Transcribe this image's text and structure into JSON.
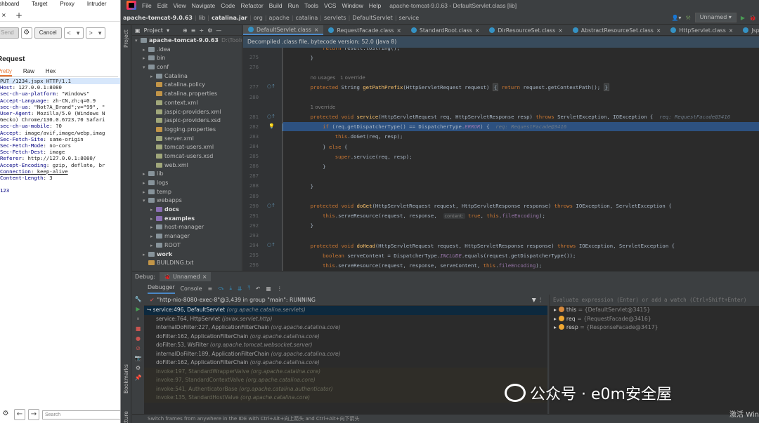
{
  "burp": {
    "menu": [
      "Dashboard",
      "Target",
      "Proxy",
      "Intruder"
    ],
    "toolbar": {
      "send": "Send",
      "settings_icon": "gear-icon",
      "cancel": "Cancel",
      "prev": "<",
      "prev_dd": "▾",
      "next": ">",
      "next_dd": "▾"
    },
    "heading": "Request",
    "tabs": [
      "Pretty",
      "Raw",
      "Hex"
    ],
    "request_lines": [
      {
        "t": "PUT /1234.jspx HTTP/1.1",
        "cls": "sel"
      },
      {
        "k": "Host",
        "v": ": 127.0.0.1:8080"
      },
      {
        "k": "sec-ch-ua-platform",
        "v": ": \"Windows\""
      },
      {
        "k": "Accept-Language",
        "v": ": zh-CN,zh;q=0.9"
      },
      {
        "k": "sec-ch-ua",
        "v": ": \"Not?A_Brand\";v=\"99\", \""
      },
      {
        "k": "User-Agent",
        "v": ": Mozilla/5.0 (Windows N"
      },
      {
        "t": "Gecko) Chrome/130.0.6723.70 Safari"
      },
      {
        "k": "sec-ch-ua-mobile",
        "v": ": ?0"
      },
      {
        "k": "Accept",
        "v": ": image/avif,image/webp,imag"
      },
      {
        "k": "Sec-Fetch-Site",
        "v": ": same-origin"
      },
      {
        "k": "Sec-Fetch-Mode",
        "v": ": no-cors"
      },
      {
        "k": "Sec-Fetch-Dest",
        "v": ": image"
      },
      {
        "k": "Referer",
        "v": ": http://127.0.0.1:8080/"
      },
      {
        "k": "Accept-Encoding",
        "v": ": gzip, deflate, br"
      },
      {
        "k": "Connection",
        "v": ": keep-alive",
        "cls": "u"
      },
      {
        "k": "Content-Length",
        "v": ": 3"
      },
      {
        "t": ""
      },
      {
        "t": "123",
        "cls": "body"
      }
    ],
    "search_placeholder": "Search"
  },
  "ide": {
    "menu": [
      "File",
      "Edit",
      "View",
      "Navigate",
      "Code",
      "Refactor",
      "Build",
      "Run",
      "Tools",
      "VCS",
      "Window",
      "Help"
    ],
    "title": "apache-tomcat-9.0.63 - DefaultServlet.class [lib]",
    "breadcrumb": [
      "apache-tomcat-9.0.63",
      "lib",
      "catalina.jar",
      "org",
      "apache",
      "catalina",
      "servlets",
      "DefaultServlet",
      "service"
    ],
    "run_config": "Unnamed",
    "left_strip": [
      "Project",
      "Bookmarks",
      "Structure"
    ],
    "project_label": "Project",
    "tree": [
      {
        "name": "apache-tomcat-9.0.63",
        "hint": "D:\\Tools\\ap",
        "type": "root",
        "depth": 0,
        "arrow": "▾"
      },
      {
        "name": ".idea",
        "type": "fo",
        "depth": 1,
        "arrow": "▸"
      },
      {
        "name": "bin",
        "type": "fo",
        "depth": 1,
        "arrow": "▸"
      },
      {
        "name": "conf",
        "type": "fo",
        "depth": 1,
        "arrow": "▾"
      },
      {
        "name": "Catalina",
        "type": "fo",
        "depth": 2,
        "arrow": "▸"
      },
      {
        "name": "catalina.policy",
        "type": "fm",
        "depth": 2
      },
      {
        "name": "catalina.properties",
        "type": "fm",
        "depth": 2
      },
      {
        "name": "context.xml",
        "type": "fx",
        "depth": 2
      },
      {
        "name": "jaspic-providers.xml",
        "type": "fx",
        "depth": 2
      },
      {
        "name": "jaspic-providers.xsd",
        "type": "fx",
        "depth": 2
      },
      {
        "name": "logging.properties",
        "type": "fm",
        "depth": 2
      },
      {
        "name": "server.xml",
        "type": "fx",
        "depth": 2
      },
      {
        "name": "tomcat-users.xml",
        "type": "fx",
        "depth": 2
      },
      {
        "name": "tomcat-users.xsd",
        "type": "fx",
        "depth": 2
      },
      {
        "name": "web.xml",
        "type": "fx",
        "depth": 2
      },
      {
        "name": "lib",
        "type": "fo",
        "depth": 1,
        "arrow": "▸"
      },
      {
        "name": "logs",
        "type": "fo",
        "depth": 1,
        "arrow": "▸"
      },
      {
        "name": "temp",
        "type": "fo",
        "depth": 1,
        "arrow": "▸"
      },
      {
        "name": "webapps",
        "type": "fo",
        "depth": 1,
        "arrow": "▾"
      },
      {
        "name": "docs",
        "type": "fw",
        "depth": 2,
        "arrow": "▸",
        "bold": true
      },
      {
        "name": "examples",
        "type": "fw",
        "depth": 2,
        "arrow": "▸",
        "bold": true
      },
      {
        "name": "host-manager",
        "type": "fo",
        "depth": 2,
        "arrow": "▸"
      },
      {
        "name": "manager",
        "type": "fo",
        "depth": 2,
        "arrow": "▸"
      },
      {
        "name": "ROOT",
        "type": "fo",
        "depth": 2,
        "arrow": "▸"
      },
      {
        "name": "work",
        "type": "fo",
        "depth": 1,
        "arrow": "▸",
        "bold": true
      },
      {
        "name": "BUILDING.txt",
        "type": "fm",
        "depth": 1
      }
    ],
    "tabs": [
      "DefaultServlet.class",
      "RequestFacade.class",
      "StandardRoot.class",
      "DirResourceSet.class",
      "AbstractResourceSet.class",
      "HttpServlet.class",
      "JspServlet.class"
    ],
    "banner": "Decompiled .class file, bytecode version: 52.0 (Java 8)",
    "code_lines": [
      {
        "n": "",
        "html": "        <span class=\"kw\">return</span> result.toString();"
      },
      {
        "n": "275",
        "html": "    }"
      },
      {
        "n": "276",
        "html": ""
      },
      {
        "n": "",
        "html": "    <span class=\"cmt\">no usages   1 override</span>"
      },
      {
        "n": "277",
        "html": "    <span class=\"kw\">protected</span> String <span class=\"fn\">getPathPrefix</span>(HttpServletRequest request) <span class=\"fold\">{</span> <span class=\"kw\">return</span> request.getContextPath(); <span class=\"fold\">}</span>",
        "g": "○↑"
      },
      {
        "n": "280",
        "html": ""
      },
      {
        "n": "",
        "html": "    <span class=\"cmt\">1 override</span>"
      },
      {
        "n": "281",
        "html": "    <span class=\"kw\">protected void</span> <span class=\"fn\">service</span>(HttpServletRequest req, HttpServletResponse resp) <span class=\"kw\">throws</span> ServletException, IOException {  <span class=\"hint\">req: RequestFacade@3416</span>",
        "g": "○↑"
      },
      {
        "n": "282",
        "html": "        <span class=\"kw\">if</span> (req.getDispatcherType() == DispatcherType.<span class=\"it\">ERROR</span>) {  <span class=\"hint\">req: RequestFacade@3416</span>",
        "hl": true,
        "g": "💡"
      },
      {
        "n": "283",
        "html": "            <span class=\"kw\">this</span>.doGet(req, resp);"
      },
      {
        "n": "284",
        "html": "        } <span class=\"kw\">else</span> {"
      },
      {
        "n": "285",
        "html": "            <span class=\"kw\">super</span>.service(req, resp);"
      },
      {
        "n": "286",
        "html": "        }"
      },
      {
        "n": "287",
        "html": ""
      },
      {
        "n": "288",
        "html": "    }"
      },
      {
        "n": "289",
        "html": ""
      },
      {
        "n": "290",
        "html": "    <span class=\"kw\">protected void</span> <span class=\"fn\">doGet</span>(HttpServletRequest request, HttpServletResponse response) <span class=\"kw\">throws</span> IOException, ServletException {",
        "g": "○↑"
      },
      {
        "n": "291",
        "html": "        <span class=\"kw\">this</span>.serveResource(request, response,  <span class=\"ann\">content:</span> <span class=\"kw\">true</span>, <span class=\"kw\">this</span>.<span class=\"fd\">fileEncoding</span>);"
      },
      {
        "n": "292",
        "html": "    }"
      },
      {
        "n": "293",
        "html": ""
      },
      {
        "n": "294",
        "html": "    <span class=\"kw\">protected void</span> <span class=\"fn\">doHead</span>(HttpServletRequest request, HttpServletResponse response) <span class=\"kw\">throws</span> IOException, ServletException {",
        "g": "○↑"
      },
      {
        "n": "295",
        "html": "        <span class=\"kw\">boolean</span> serveContent = DispatcherType.<span class=\"it\">INCLUDE</span>.equals(request.getDispatcherType());"
      },
      {
        "n": "296",
        "html": "        <span class=\"kw\">this</span>.serveResource(request, response, serveContent, <span class=\"kw\">this</span>.<span class=\"fd\">fileEncoding</span>);"
      }
    ],
    "debug": {
      "label": "Debug:",
      "session": "Unnamed",
      "tabs": [
        "Debugger",
        "Console"
      ],
      "thread": "\"http-nio-8080-exec-8\"@3,439 in group \"main\": RUNNING",
      "frames": [
        {
          "m": "service:496, DefaultServlet",
          "c": "(org.apache.catalina.servlets)",
          "cur": true
        },
        {
          "m": "service:764, HttpServlet",
          "c": "(javax.servlet.http)"
        },
        {
          "m": "internalDoFilter:227, ApplicationFilterChain",
          "c": "(org.apache.catalina.core)"
        },
        {
          "m": "doFilter:162, ApplicationFilterChain",
          "c": "(org.apache.catalina.core)"
        },
        {
          "m": "doFilter:53, WsFilter",
          "c": "(org.apache.tomcat.websocket.server)"
        },
        {
          "m": "internalDoFilter:189, ApplicationFilterChain",
          "c": "(org.apache.catalina.core)"
        },
        {
          "m": "doFilter:162, ApplicationFilterChain",
          "c": "(org.apache.catalina.core)"
        },
        {
          "m": "invoke:197, StandardWrapperValve",
          "c": "(org.apache.catalina.core)",
          "dim": true
        },
        {
          "m": "invoke:97, StandardContextValve",
          "c": "(org.apache.catalina.core)",
          "dim": true
        },
        {
          "m": "invoke:541, AuthenticatorBase",
          "c": "(org.apache.catalina.authenticator)",
          "dim": true
        },
        {
          "m": "invoke:135, StandardHostValve",
          "c": "(org.apache.catalina.core)",
          "dim": true
        }
      ],
      "eval_placeholder": "Evaluate expression (Enter) or add a watch (Ctrl+Shift+Enter)",
      "vars": [
        {
          "name": "this",
          "val": "= {DefaultServlet@3415}",
          "c": "r"
        },
        {
          "name": "req",
          "val": "= {RequestFacade@3416}"
        },
        {
          "name": "resp",
          "val": "= {ResponseFacade@3417}"
        }
      ],
      "status": "Switch frames from anywhere in the IDE with Ctrl+Alt+向上箭头 and Ctrl+Alt+向下箭头"
    }
  },
  "watermark": {
    "text": "公众号 · e0m安全屋",
    "activate": "激活 Win"
  }
}
